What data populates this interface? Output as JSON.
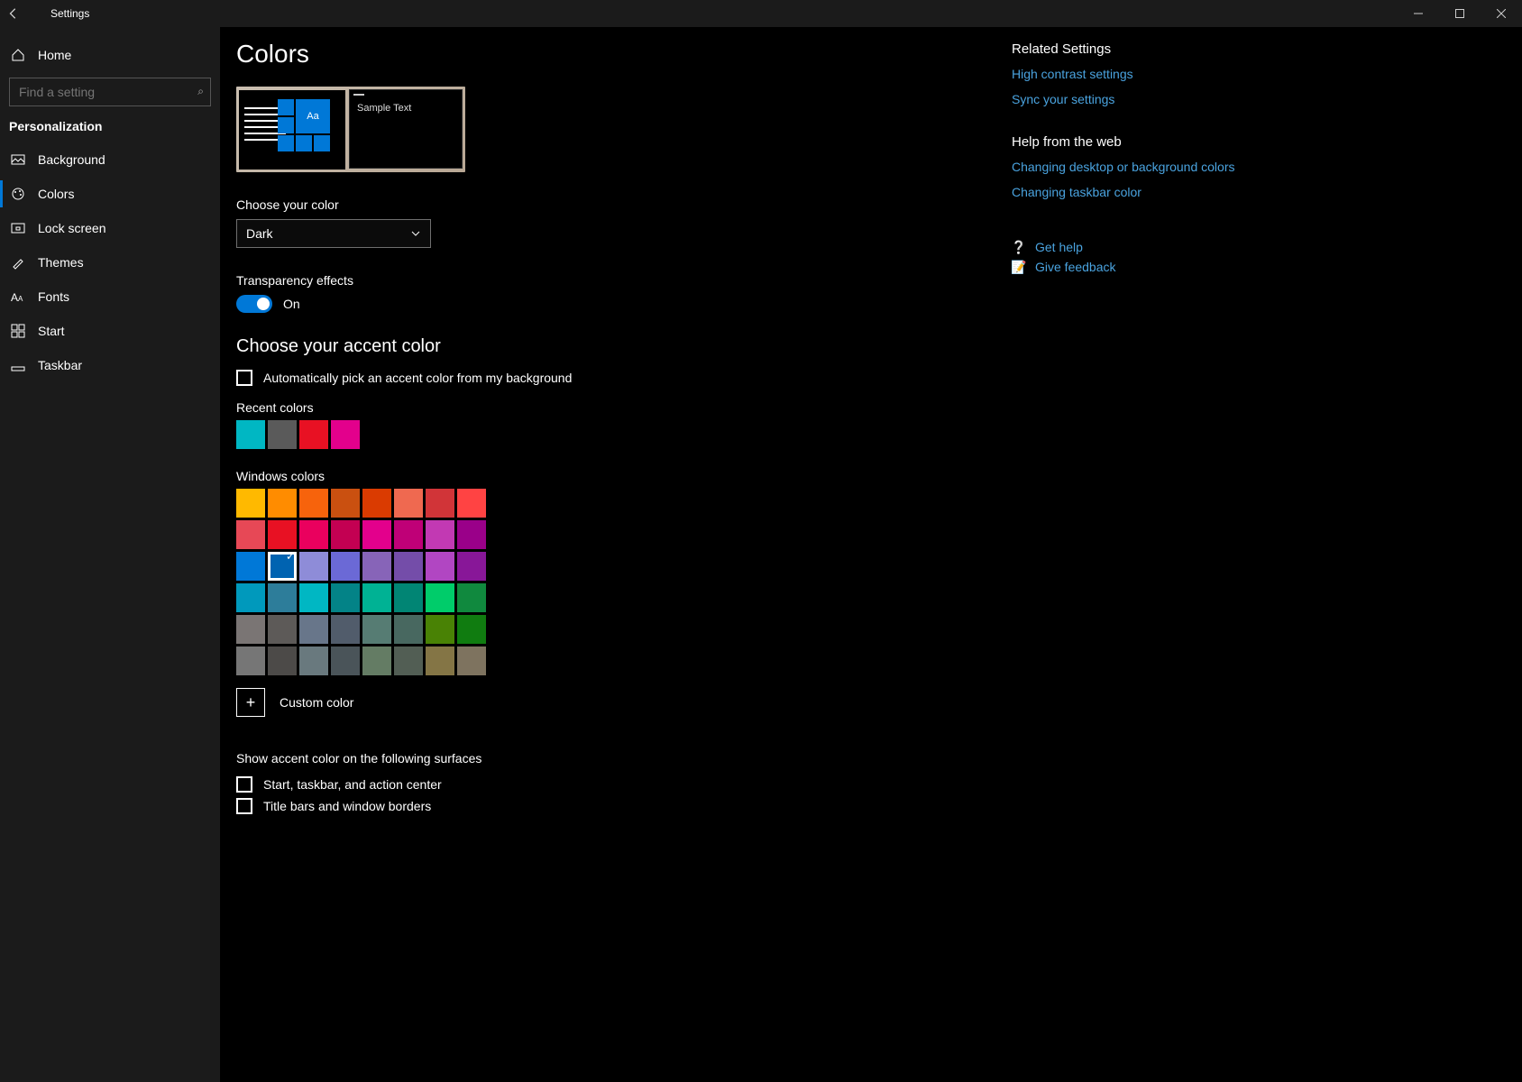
{
  "titlebar": {
    "title": "Settings"
  },
  "sidebar": {
    "home": "Home",
    "search_placeholder": "Find a setting",
    "section": "Personalization",
    "items": [
      {
        "label": "Background",
        "icon": "background"
      },
      {
        "label": "Colors",
        "icon": "colors",
        "selected": true
      },
      {
        "label": "Lock screen",
        "icon": "lock-screen"
      },
      {
        "label": "Themes",
        "icon": "themes"
      },
      {
        "label": "Fonts",
        "icon": "fonts"
      },
      {
        "label": "Start",
        "icon": "start"
      },
      {
        "label": "Taskbar",
        "icon": "taskbar"
      }
    ]
  },
  "page": {
    "title": "Colors",
    "preview_sample": "Sample Text",
    "preview_tile": "Aa",
    "choose_color_label": "Choose your color",
    "color_mode_value": "Dark",
    "transparency_label": "Transparency effects",
    "transparency_state": "On",
    "accent_heading": "Choose your accent color",
    "auto_pick_label": "Automatically pick an accent color from my background",
    "auto_pick_checked": false,
    "recent_label": "Recent colors",
    "recent_colors": [
      "#00b7c3",
      "#5a5a5a",
      "#e81123",
      "#e3008c"
    ],
    "windows_label": "Windows colors",
    "selected_color": "#0063b1",
    "windows_colors": [
      "#ffb900",
      "#ff8c00",
      "#f7630c",
      "#ca5010",
      "#da3b01",
      "#ef6950",
      "#d13438",
      "#ff4343",
      "#e74856",
      "#e81123",
      "#ea005e",
      "#c30052",
      "#e3008c",
      "#bf0077",
      "#c239b3",
      "#9a0089",
      "#0078d7",
      "#0063b1",
      "#8e8cd8",
      "#6b69d6",
      "#8764b8",
      "#744da9",
      "#b146c2",
      "#881798",
      "#0099bc",
      "#2d7d9a",
      "#00b7c3",
      "#038387",
      "#00b294",
      "#018574",
      "#00cc6a",
      "#10893e",
      "#7a7574",
      "#5d5a58",
      "#68768a",
      "#515c6b",
      "#567c73",
      "#486860",
      "#498205",
      "#107c10",
      "#767676",
      "#4c4a48",
      "#69797e",
      "#4a5459",
      "#647c64",
      "#525e54",
      "#847545",
      "#7e735f"
    ],
    "custom_label": "Custom color",
    "surfaces_heading": "Show accent color on the following surfaces",
    "surface_start": "Start, taskbar, and action center",
    "surface_title": "Title bars and window borders"
  },
  "rail": {
    "related_heading": "Related Settings",
    "links": [
      "High contrast settings",
      "Sync your settings"
    ],
    "help_heading": "Help from the web",
    "help_links": [
      "Changing desktop or background colors",
      "Changing taskbar color"
    ],
    "get_help": "Get help",
    "feedback": "Give feedback"
  }
}
